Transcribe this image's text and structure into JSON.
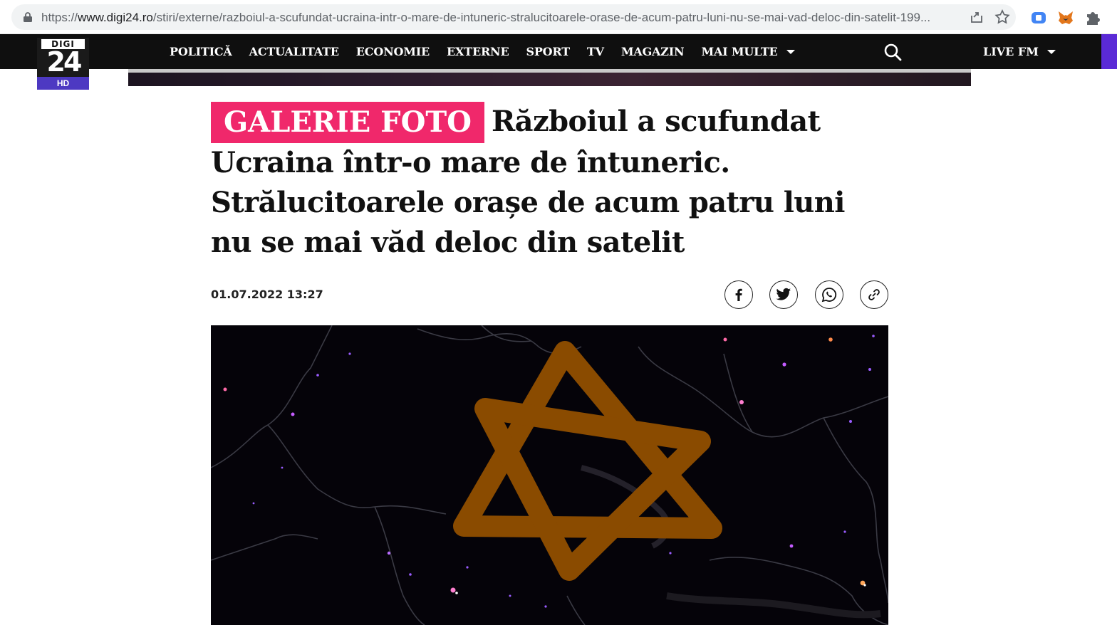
{
  "browser": {
    "url_prefix": "https://",
    "url_host": "www.digi24.ro",
    "url_path": "/stiri/externe/razboiul-a-scufundat-ucraina-intr-o-mare-de-intuneric-stralucitoarele-orase-de-acum-patru-luni-nu-se-mai-vad-deloc-din-satelit-199..."
  },
  "site": {
    "logo_top": "DIGI",
    "logo_number": "24",
    "logo_badge": "HD",
    "nav": [
      "POLITICĂ",
      "ACTUALITATE",
      "ECONOMIE",
      "EXTERNE",
      "SPORT",
      "TV",
      "MAGAZIN",
      "MAI MULTE"
    ],
    "live_label": "LIVE FM"
  },
  "article": {
    "tag": "GALERIE FOTO",
    "title": "Războiul a scufundat Ucraina într-o mare de întuneric. Strălucitoarele orașe de acum patru luni nu se mai văd deloc din satelit",
    "date": "01.07.2022 13:27",
    "share": [
      "facebook-icon",
      "twitter-icon",
      "whatsapp-icon",
      "link-icon"
    ]
  },
  "colors": {
    "tag_bg": "#f0286b",
    "header_bg": "#0f0f0f",
    "logo_badge_bg": "#4d39c2",
    "star_overlay": "#8a4b00"
  }
}
